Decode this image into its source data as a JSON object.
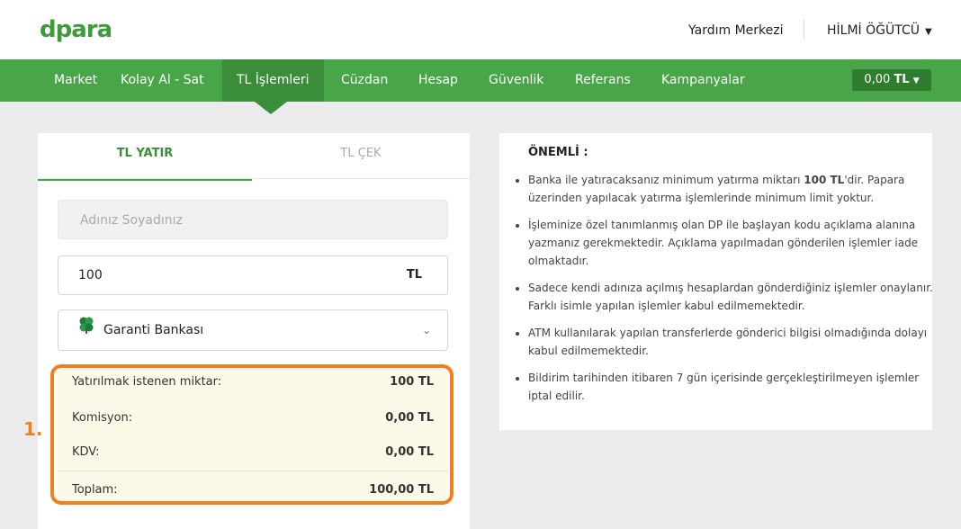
{
  "header": {
    "logo": "dpara",
    "help": "Yardım Merkezi",
    "user": "HİLMİ ÖĞÜTCÜ"
  },
  "nav": {
    "items": [
      "Market",
      "Kolay Al - Sat",
      "TL İşlemleri",
      "Cüzdan",
      "Hesap",
      "Güvenlik",
      "Referans",
      "Kampanyalar"
    ],
    "active": "TL İşlemleri",
    "balance_amount": "0,00",
    "balance_currency": "TL"
  },
  "tabs": {
    "deposit": "TL YATIR",
    "withdraw": "TL ÇEK"
  },
  "form": {
    "name_placeholder": "Adınız Soyadınız",
    "amount": "100",
    "amount_currency": "TL",
    "bank": "Garanti Bankası"
  },
  "summary": {
    "rows": [
      {
        "label": "Yatırılmak istenen miktar:",
        "value": "100 TL"
      },
      {
        "label": "Komisyon:",
        "value": "0,00 TL"
      },
      {
        "label": "KDV:",
        "value": "0,00 TL"
      },
      {
        "label": "Toplam:",
        "value": "100,00 TL"
      }
    ]
  },
  "annotation": {
    "step": "1."
  },
  "info": {
    "title": "ÖNEMLİ :",
    "items": [
      "Banka ile yatıracaksanız minimum yatırma miktarı 100 TL'dir. Papara üzerinden yapılacak yatırma işlemlerinde minimum limit yoktur.",
      "İşleminize özel tanımlanmış olan DP ile başlayan kodu açıklama alanına yazmanız gerekmektedir. Açıklama yapılmadan gönderilen işlemler iade olmaktadır.",
      "Sadece kendi adınıza açılmış hesaplardan gönderdiğiniz işlemler onaylanır. Farklı isimle yapılan işlemler kabul edilmemektedir.",
      "ATM kullanılarak yapılan transferlerde gönderici bilgisi olmadığında dolayı kabul edilmemektedir.",
      "Bildirim tarihinden itibaren 7 gün içerisinde gerçekleştirilmeyen işlemler iptal edilir."
    ]
  },
  "colors": {
    "brand": "#48a548",
    "active_nav": "#3a8e39",
    "highlight": "#f0801e"
  }
}
